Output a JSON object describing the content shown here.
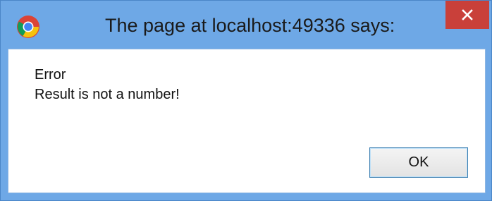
{
  "window": {
    "title": "The page at localhost:49336 says:",
    "app_icon": "chrome-icon",
    "close_icon": "close-icon",
    "accent_color": "#6ea8e6",
    "close_color": "#c9403a"
  },
  "message": {
    "lines": [
      "Error",
      "Result is not a number!"
    ]
  },
  "buttons": {
    "ok_label": "OK"
  }
}
